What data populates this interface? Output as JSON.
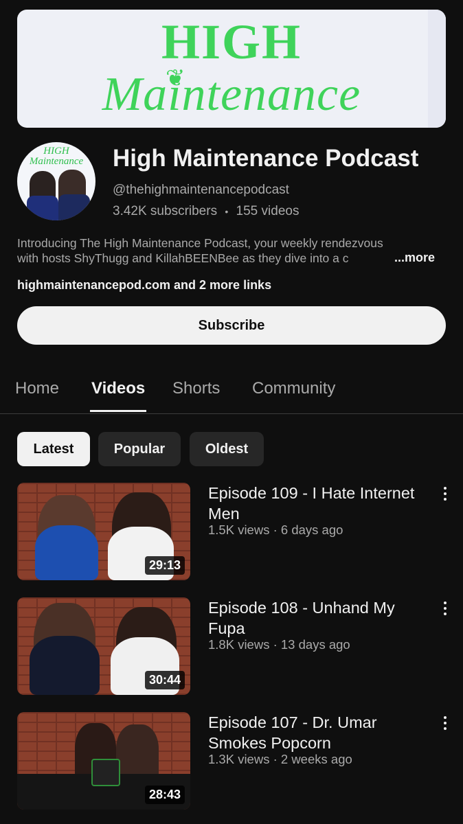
{
  "banner": {
    "line1": "HIGH",
    "line2": "Maintenance"
  },
  "avatar": {
    "text_line1": "HIGH",
    "text_line2": "Maintenance"
  },
  "channel": {
    "title": "High Maintenance Podcast",
    "handle": "@thehighmaintenancepodcast",
    "subscribers": "3.42K subscribers",
    "videos": "155 videos",
    "separator": "•",
    "description_line1": "Introducing The High Maintenance Podcast, your weekly rendezvous",
    "description_line2": "with hosts ShyThugg and KillahBEENBee as they dive into a c",
    "more_label": "...more",
    "link_text": "highmaintenancepod.com",
    "more_links_text": " and 2 more links"
  },
  "subscribe_label": "Subscribe",
  "tabs": [
    {
      "label": "Home"
    },
    {
      "label": "Videos"
    },
    {
      "label": "Shorts"
    },
    {
      "label": "Community"
    }
  ],
  "chips": [
    {
      "label": "Latest"
    },
    {
      "label": "Popular"
    },
    {
      "label": "Oldest"
    }
  ],
  "videos": [
    {
      "title": "Episode 109 - I Hate Internet Men",
      "meta": "1.5K views · 6 days ago",
      "duration": "29:13"
    },
    {
      "title": "Episode 108 - Unhand My Fupa",
      "meta": "1.8K views · 13 days ago",
      "duration": "30:44"
    },
    {
      "title": "Episode 107 - Dr. Umar Smokes Popcorn",
      "meta": "1.3K views · 2 weeks ago",
      "duration": "28:43"
    }
  ],
  "colors": {
    "background": "#0f0f0f",
    "banner_green": "#3fd35a",
    "text_primary": "#f1f1f1",
    "text_secondary": "#aaaaaa"
  }
}
